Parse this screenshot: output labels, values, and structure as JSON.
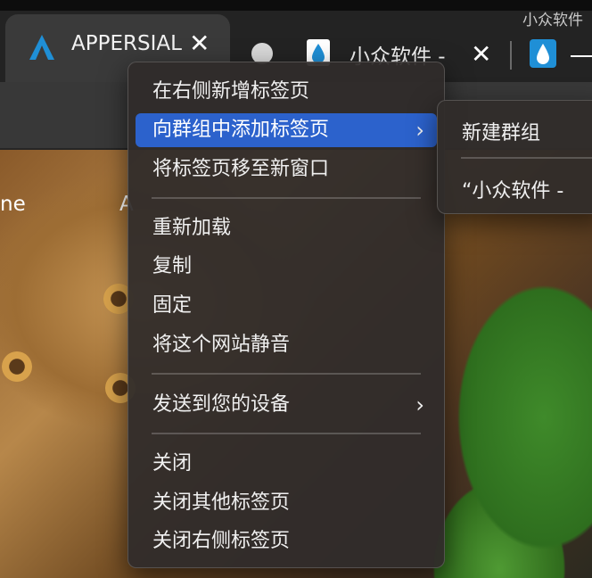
{
  "watermark": "小众软件",
  "tabs": [
    {
      "title": "APPERSIAL",
      "close": "✕",
      "active": true
    },
    {
      "title": "小众软件 -",
      "close": "✕",
      "active": false
    },
    {
      "title": "",
      "active": false
    }
  ],
  "page": {
    "text_left": "ne",
    "text_mid": "A"
  },
  "context_menu": {
    "items": [
      {
        "label": "在右侧新增标签页"
      },
      {
        "label": "向群组中添加标签页",
        "submenu": true,
        "highlighted": true
      },
      {
        "label": "将标签页移至新窗口"
      },
      {
        "label": "重新加载"
      },
      {
        "label": "复制"
      },
      {
        "label": "固定"
      },
      {
        "label": "将这个网站静音"
      },
      {
        "label": "发送到您的设备",
        "submenu": true
      },
      {
        "label": "关闭"
      },
      {
        "label": "关闭其他标签页"
      },
      {
        "label": "关闭右侧标签页"
      }
    ],
    "chevron": "›"
  },
  "submenu": {
    "items": [
      {
        "label": "新建群组"
      },
      {
        "label": "“小众软件 -"
      }
    ]
  },
  "colors": {
    "highlight": "#2c62cc",
    "logo_accent": "#1f8fd6"
  }
}
